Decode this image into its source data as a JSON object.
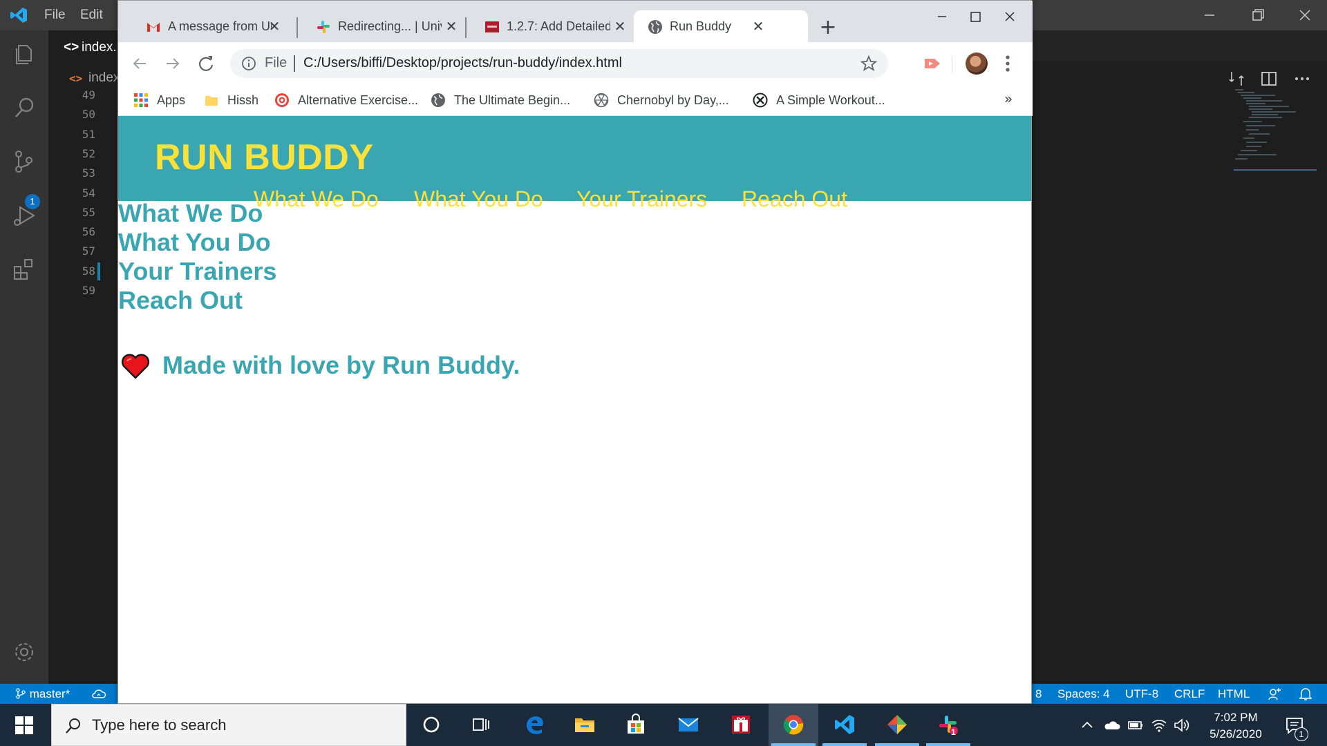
{
  "vscode": {
    "menu": [
      "File",
      "Edit"
    ],
    "editor_tab": "index.",
    "breadcrumb": "index",
    "line_numbers": [
      "49",
      "50",
      "51",
      "52",
      "53",
      "54",
      "55",
      "56",
      "57",
      "58",
      "59"
    ],
    "scm_badge": "1",
    "status": {
      "branch": "master*",
      "ln_partial": "8",
      "spaces": "Spaces: 4",
      "encoding": "UTF-8",
      "eol": "CRLF",
      "language": "HTML"
    }
  },
  "chrome": {
    "tabs": [
      {
        "title": "A message from UCF",
        "favicon": "gmail-icon"
      },
      {
        "title": "Redirecting... | University",
        "favicon": "slack-icon"
      },
      {
        "title": "1.2.7: Add Detailed",
        "favicon": "canvas-icon"
      },
      {
        "title": "Run Buddy",
        "favicon": "globe-icon",
        "active": true
      }
    ],
    "address": {
      "scheme_label": "File",
      "url": "C:/Users/biffi/Desktop/projects/run-buddy/index.html"
    },
    "bookmarks": [
      {
        "label": "Apps",
        "icon": "apps-grid-icon"
      },
      {
        "label": "Hissh",
        "icon": "folder-icon"
      },
      {
        "label": "Alternative Exercise...",
        "icon": "target-icon"
      },
      {
        "label": "The Ultimate Begin...",
        "icon": "globe-icon"
      },
      {
        "label": "Chernobyl by Day,...",
        "icon": "radiation-icon"
      },
      {
        "label": "A Simple Workout...",
        "icon": "x-circle-icon"
      }
    ],
    "bookmarks_overflow": "»"
  },
  "page": {
    "site_title": "RUN BUDDY",
    "top_nav": [
      "What We Do",
      "What You Do",
      "Your Trainers",
      "Reach Out"
    ],
    "side_links": [
      "What We Do",
      "What You Do",
      "Your Trainers",
      "Reach Out"
    ],
    "footer_text": "Made with love by Run Buddy.",
    "colors": {
      "primary": "#39a6b2",
      "accent": "#fce138"
    }
  },
  "taskbar": {
    "search_placeholder": "Type here to search",
    "apps": [
      "cortana-icon",
      "task-view-icon",
      "edge-icon",
      "file-explorer-icon",
      "store-icon",
      "mail-icon",
      "gift-icon",
      "chrome-icon",
      "vscode-icon",
      "git-icon",
      "slack-icon"
    ],
    "time": "7:02 PM",
    "date": "5/26/2020",
    "slack_badge": "1",
    "notif_count": "1"
  }
}
